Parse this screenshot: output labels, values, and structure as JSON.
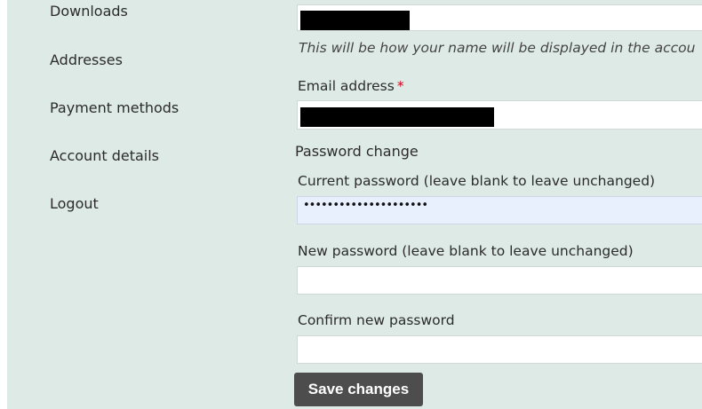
{
  "sidebar": {
    "items": [
      {
        "label": "Downloads"
      },
      {
        "label": "Addresses"
      },
      {
        "label": "Payment methods"
      },
      {
        "label": "Account details"
      },
      {
        "label": "Logout"
      }
    ]
  },
  "form": {
    "display_name_hint": "This will be how your name will be displayed in the accou",
    "email_label": "Email address",
    "required_mark": "*",
    "password_legend": "Password change",
    "current_password_label": "Current password (leave blank to leave unchanged)",
    "current_password_value": "•••••••••••••••••••••",
    "new_password_label": "New password (leave blank to leave unchanged)",
    "confirm_password_label": "Confirm new password",
    "save_label": "Save changes"
  }
}
